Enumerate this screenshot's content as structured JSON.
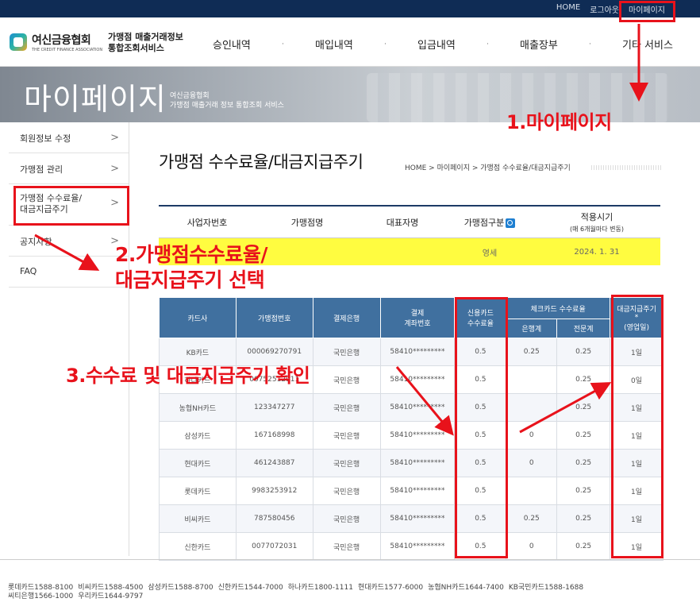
{
  "topbar": {
    "home": "HOME",
    "logout": "로그아웃",
    "mypage": "마이페이지"
  },
  "logo": {
    "ko": "여신금융협회",
    "en": "THE CREDIT FINANCE ASSOCIATION"
  },
  "service": {
    "line1": "가맹점 매출거래정보",
    "line2": "통합조회서비스"
  },
  "nav": [
    "승인내역",
    "매입내역",
    "입금내역",
    "매출장부",
    "기타 서비스"
  ],
  "banner": {
    "title": "마이페이지",
    "sub1": "여신금융협회",
    "sub2": "가맹점 매출거래 정보 통합조회 서비스"
  },
  "sidebar": [
    {
      "label": "회원정보 수정"
    },
    {
      "label": "가맹점 관리"
    },
    {
      "label1": "가맹점 수수료율/",
      "label2": "대금지급주기"
    },
    {
      "label": "공지사항"
    },
    {
      "label": "FAQ"
    }
  ],
  "page_title": "가맹점 수수료율/대금지급주기",
  "breadcrumb": {
    "home": "HOME",
    "mypage": "마이페이지",
    "current": "가맹점 수수료율/대금지급주기"
  },
  "info": {
    "headers": {
      "bizno": "사업자번호",
      "store": "가맹점명",
      "ceo": "대표자명",
      "type": "가맹점구분",
      "apply": "적용시기",
      "apply_note": "(매 6개월마다 변동)"
    },
    "row": {
      "bizno": "",
      "store": "",
      "ceo": "",
      "type": "영세",
      "apply": "2024. 1. 31"
    }
  },
  "fees": {
    "headers": {
      "card": "카드사",
      "merchant": "가맹점번호",
      "bank": "결제은행",
      "account1": "결제",
      "account2": "계좌번호",
      "credit1": "신용카드",
      "credit2": "수수료율",
      "check": "체크카드 수수료율",
      "check_a": "은행계",
      "check_b": "전문계",
      "cycle1": "대금지급주기",
      "cycle2": "*",
      "cycle3": "(영업일)"
    },
    "rows": [
      {
        "card": "KB카드",
        "merchant": "000069270791",
        "bank": "국민은행",
        "account": "58410*********",
        "credit": "0.5",
        "check_a": "0.25",
        "check_b": "0.25",
        "cycle": "1일"
      },
      {
        "card": "하나카드",
        "merchant": "00752512911",
        "bank": "국민은행",
        "account": "58410*********",
        "credit": "0.5",
        "check_a": "",
        "check_b": "0.25",
        "cycle": "0일"
      },
      {
        "card": "농협NH카드",
        "merchant": "123347277",
        "bank": "국민은행",
        "account": "58410*********",
        "credit": "0.5",
        "check_a": "",
        "check_b": "0.25",
        "cycle": "1일"
      },
      {
        "card": "삼성카드",
        "merchant": "167168998",
        "bank": "국민은행",
        "account": "58410*********",
        "credit": "0.5",
        "check_a": "0",
        "check_b": "0.25",
        "cycle": "1일"
      },
      {
        "card": "현대카드",
        "merchant": "461243887",
        "bank": "국민은행",
        "account": "58410*********",
        "credit": "0.5",
        "check_a": "0",
        "check_b": "0.25",
        "cycle": "1일"
      },
      {
        "card": "롯데카드",
        "merchant": "9983253912",
        "bank": "국민은행",
        "account": "58410*********",
        "credit": "0.5",
        "check_a": "",
        "check_b": "0.25",
        "cycle": "1일"
      },
      {
        "card": "비씨카드",
        "merchant": "787580456",
        "bank": "국민은행",
        "account": "58410*********",
        "credit": "0.5",
        "check_a": "0.25",
        "check_b": "0.25",
        "cycle": "1일"
      },
      {
        "card": "신한카드",
        "merchant": "0077072031",
        "bank": "국민은행",
        "account": "58410*********",
        "credit": "0.5",
        "check_a": "0",
        "check_b": "0.25",
        "cycle": "1일"
      }
    ]
  },
  "annotations": {
    "step1": "1.마이페이지",
    "step2a": "2.가맹점수수료율/",
    "step2b": "대금지급주기 선택",
    "step3": "3.수수료 및 대금지급주기 확인"
  },
  "colors": {
    "annotation": "#e8121b",
    "navy": "#0f2c55",
    "table_header": "#40709f",
    "highlight": "#fffc40"
  },
  "footer": {
    "line1": [
      "롯데카드1588-8100",
      "비씨카드1588-4500",
      "삼성카드1588-8700",
      "신한카드1544-7000",
      "하나카드1800-1111",
      "현대카드1577-6000",
      "농협NH카드1644-7400",
      "KB국민카드1588-1688"
    ],
    "line2": [
      "씨티은행1566-1000",
      "우리카드1644-9797"
    ]
  }
}
